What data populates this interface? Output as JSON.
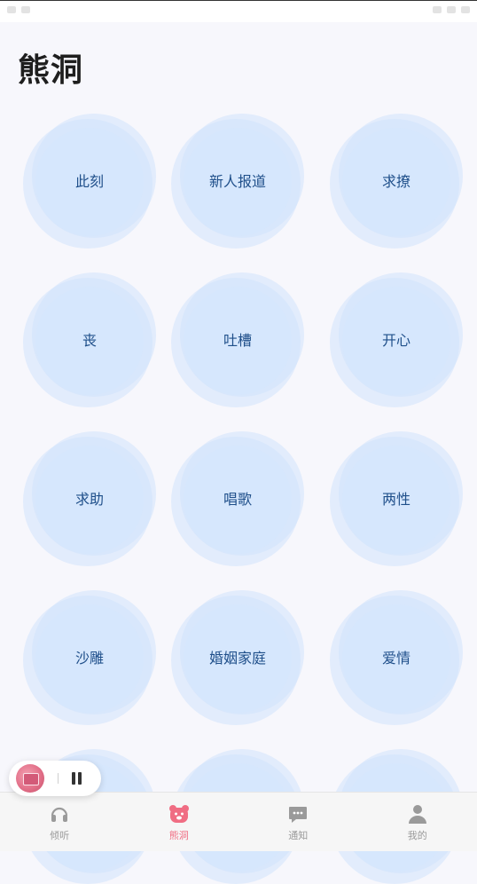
{
  "app": {
    "title": "熊洞"
  },
  "topics": [
    {
      "label": "此刻"
    },
    {
      "label": "新人报道"
    },
    {
      "label": "求撩"
    },
    {
      "label": "丧"
    },
    {
      "label": "吐槽"
    },
    {
      "label": "开心"
    },
    {
      "label": "求助"
    },
    {
      "label": "唱歌"
    },
    {
      "label": "两性"
    },
    {
      "label": "沙雕"
    },
    {
      "label": "婚姻家庭"
    },
    {
      "label": "爱情"
    },
    {
      "label": ""
    },
    {
      "label": ""
    },
    {
      "label": ""
    }
  ],
  "mini_player": {
    "cover_icon": "album-cover-icon",
    "control_icon": "pause-icon"
  },
  "tabbar": {
    "items": [
      {
        "label": "倾听",
        "icon": "headphones-icon",
        "active": false
      },
      {
        "label": "熊洞",
        "icon": "bear-icon",
        "active": true
      },
      {
        "label": "通知",
        "icon": "chat-icon",
        "active": false
      },
      {
        "label": "我的",
        "icon": "user-icon",
        "active": false
      }
    ]
  },
  "colors": {
    "accent": "#f06d83",
    "bubble": "#d6e7fd",
    "bubble_text": "#1f4f8a",
    "background": "#f7f7fc"
  }
}
